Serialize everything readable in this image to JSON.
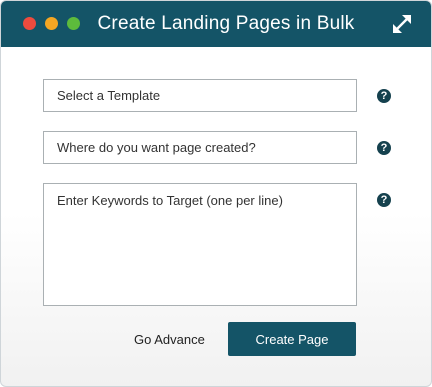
{
  "window": {
    "title": "Create Landing Pages in Bulk",
    "controls": {
      "close_color": "#ee4b3e",
      "minimize_color": "#f4a623",
      "maximize_color": "#5dbb3c"
    },
    "expand_icon": "expand-arrows-icon"
  },
  "form": {
    "template": {
      "placeholder": "Select a Template",
      "value": ""
    },
    "location": {
      "placeholder": "Where do you want page created?",
      "value": ""
    },
    "keywords": {
      "placeholder": "Enter Keywords to Target (one per line)",
      "value": ""
    },
    "help_glyph": "?",
    "help_icon": "question-circle-icon"
  },
  "actions": {
    "advance_label": "Go Advance",
    "create_label": "Create Page"
  },
  "colors": {
    "titlebar": "#145467",
    "primary_button": "#145467",
    "help_icon": "#15414e"
  }
}
